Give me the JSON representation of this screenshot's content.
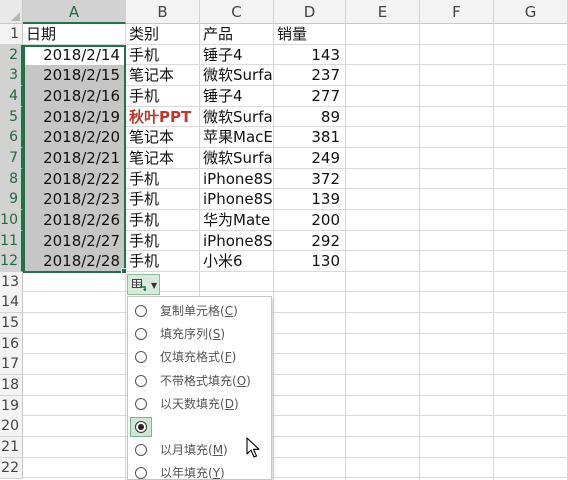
{
  "sheet": {
    "columns": [
      "A",
      "B",
      "C",
      "D",
      "E",
      "F",
      "G"
    ],
    "selected_column": "A",
    "rows": [
      "1",
      "2",
      "3",
      "4",
      "5",
      "6",
      "7",
      "8",
      "9",
      "10",
      "11",
      "12",
      "13",
      "14",
      "15",
      "16",
      "17",
      "18",
      "19",
      "20",
      "21",
      "22"
    ],
    "header_row": [
      "日期",
      "类别",
      "产品",
      "销量"
    ],
    "data": [
      {
        "date": "2018/2/14",
        "category": "手机",
        "product": "锤子4",
        "sales": "143"
      },
      {
        "date": "2018/2/15",
        "category": "笔记本",
        "product": "微软Surfa",
        "sales": "237"
      },
      {
        "date": "2018/2/16",
        "category": "手机",
        "product": "锤子4",
        "sales": "277"
      },
      {
        "date": "2018/2/19",
        "category": "秋叶PPT",
        "product": "微软Surfa",
        "sales": "89"
      },
      {
        "date": "2018/2/20",
        "category": "笔记本",
        "product": "苹果MacE",
        "sales": "381"
      },
      {
        "date": "2018/2/21",
        "category": "笔记本",
        "product": "微软Surfa",
        "sales": "249"
      },
      {
        "date": "2018/2/22",
        "category": "手机",
        "product": "iPhone8S",
        "sales": "372"
      },
      {
        "date": "2018/2/23",
        "category": "手机",
        "product": "iPhone8S",
        "sales": "139"
      },
      {
        "date": "2018/2/26",
        "category": "手机",
        "product": "华为Mate",
        "sales": "200"
      },
      {
        "date": "2018/2/27",
        "category": "手机",
        "product": "iPhone8S",
        "sales": "292"
      },
      {
        "date": "2018/2/28",
        "category": "手机",
        "product": "小米6",
        "sales": "130"
      }
    ],
    "watermark_color": "#c0392b",
    "accent_color": "#217346"
  },
  "autofill_menu": {
    "button_icon": "autofill-options-icon",
    "items": [
      {
        "text": "复制单元格(",
        "key": "C",
        "end": ")",
        "checked": false
      },
      {
        "text": "填充序列(",
        "key": "S",
        "end": ")",
        "checked": false
      },
      {
        "text": "仅填充格式(",
        "key": "F",
        "end": ")",
        "checked": false
      },
      {
        "text": "不带格式填充(",
        "key": "O",
        "end": ")",
        "checked": false
      },
      {
        "text": "以天数填充(",
        "key": "D",
        "end": ")",
        "checked": false
      },
      {
        "text": "",
        "key": "",
        "end": "",
        "checked": true
      },
      {
        "text": "以月填充(",
        "key": "M",
        "end": ")",
        "checked": false
      },
      {
        "text": "以年填充(",
        "key": "Y",
        "end": ")",
        "checked": false
      }
    ]
  }
}
